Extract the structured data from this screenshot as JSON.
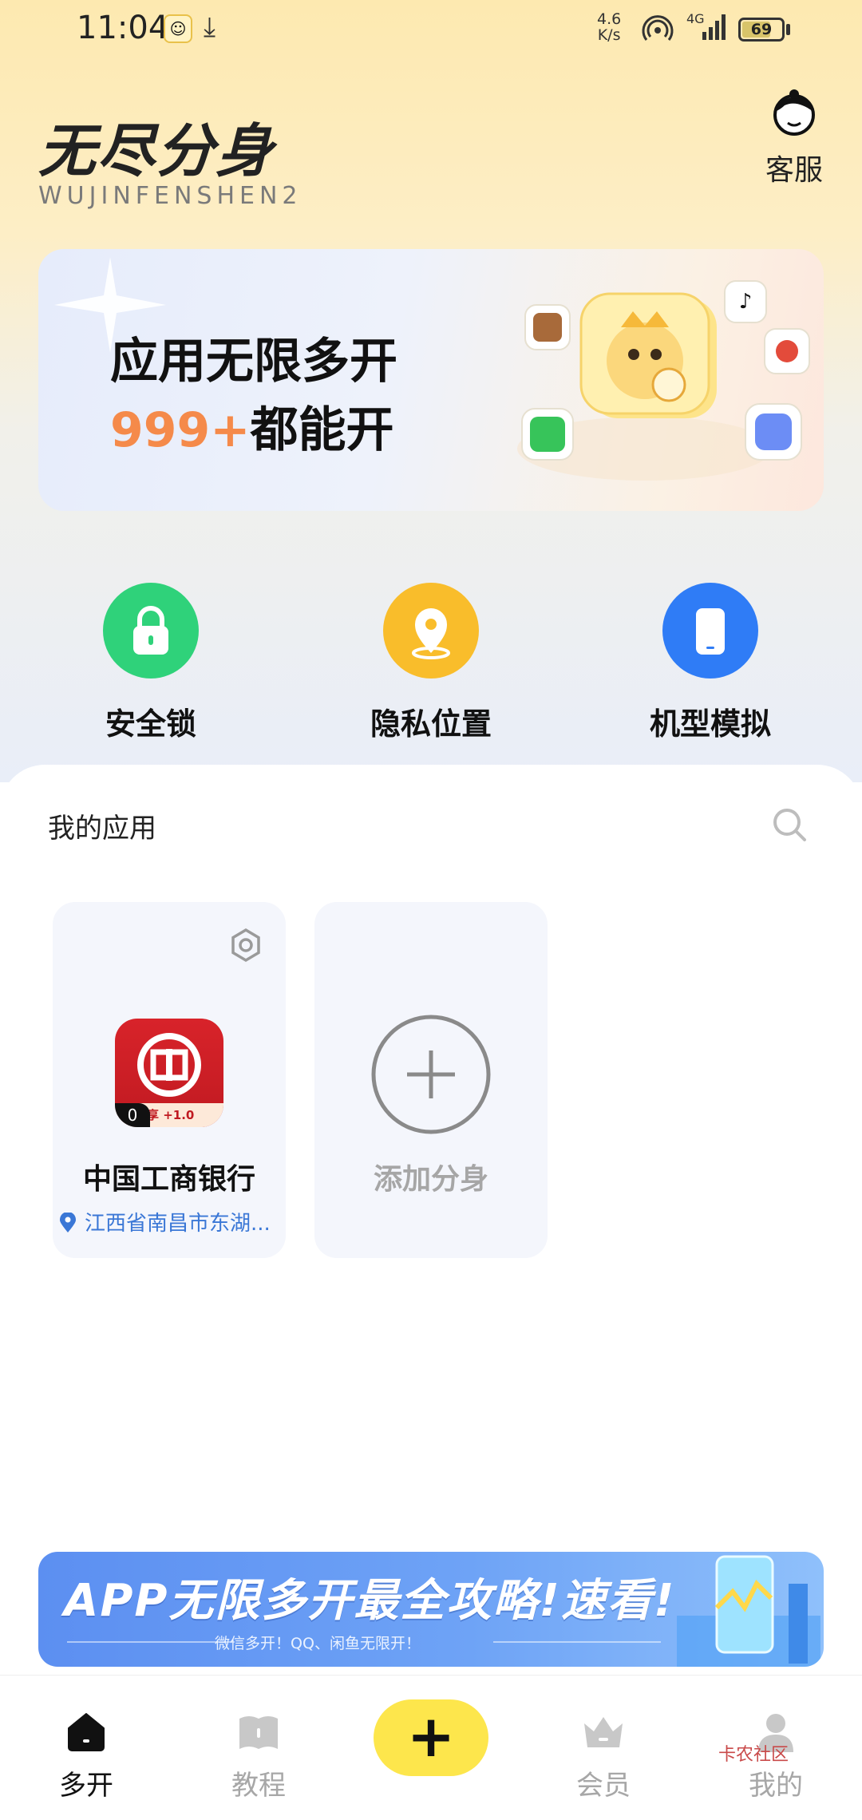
{
  "status_bar": {
    "time": "11:04",
    "speed_value": "4.6",
    "speed_unit": "K/s",
    "network": "4G",
    "battery": "69"
  },
  "header": {
    "title": "无尽分身",
    "subtitle": "WUJINFENSHEN2",
    "service_label": "客服"
  },
  "banner": {
    "line1": "应用无限多开",
    "line2_accent": "999+",
    "line2_rest": "都能开"
  },
  "features": [
    {
      "label": "安全锁",
      "color": "#2fd27a"
    },
    {
      "label": "隐私位置",
      "color": "#f9bd2b"
    },
    {
      "label": "机型模拟",
      "color": "#2f7cf6"
    }
  ],
  "apps": {
    "title": "我的应用",
    "items": [
      {
        "name": "中国工商银行",
        "badge_count": "0",
        "badge_text": "享 +1.0",
        "location": "江西省南昌市东湖..."
      }
    ],
    "add_label": "添加分身"
  },
  "promo": {
    "title": "APP无限多开最全攻略!速看!",
    "subtitle": "微信多开！QQ、闲鱼无限开！"
  },
  "nav": {
    "items": [
      {
        "label": "多开",
        "active": true
      },
      {
        "label": "教程",
        "active": false
      },
      {
        "label": "会员",
        "active": false
      },
      {
        "label": "我的",
        "active": false
      }
    ],
    "plus": "+"
  },
  "watermark": "卡农社区"
}
